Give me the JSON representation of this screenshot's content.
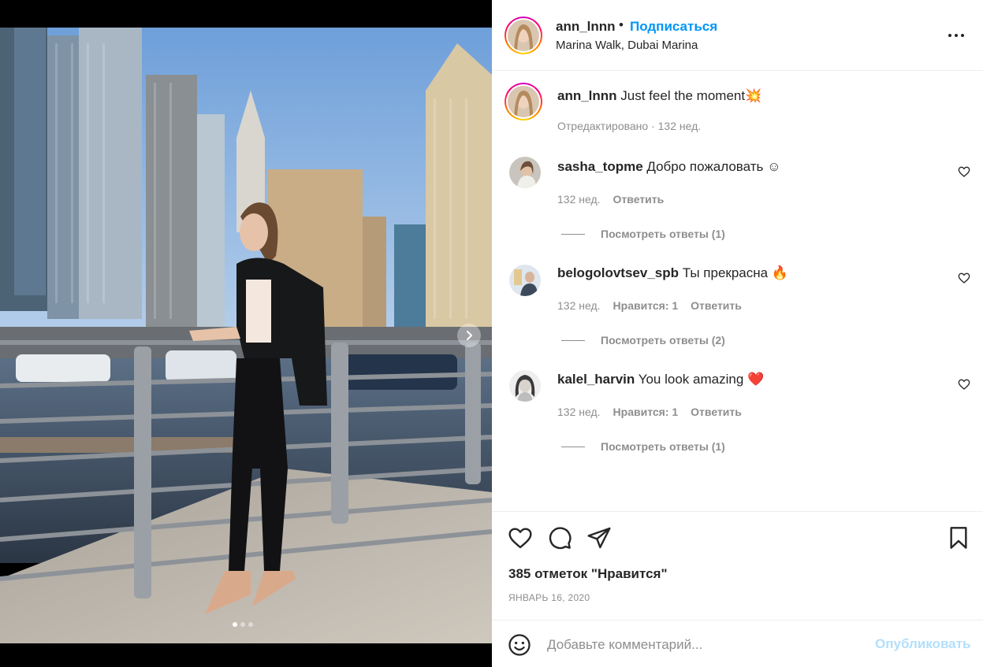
{
  "post": {
    "username": "ann_lnnn",
    "dot": "•",
    "follow_label": "Подписаться",
    "location": "Marina Walk, Dubai Marina",
    "more_icon": "more-horizontal-icon"
  },
  "media": {
    "carousel_dots": 3,
    "active_dot": 0,
    "next_icon": "chevron-right-icon"
  },
  "caption": {
    "username": "ann_lnnn",
    "text": " Just feel the moment",
    "emoji": "💥",
    "meta": "Отредактировано · 132 нед."
  },
  "comments": [
    {
      "username": "sasha_topme",
      "text": " Добро пожаловать ☺",
      "emoji": "",
      "time": "132 нед.",
      "likes_label": "",
      "reply_label": "Ответить",
      "view_replies": "Посмотреть ответы (1)"
    },
    {
      "username": "belogolovtsev_spb",
      "text": " Ты прекрасна ",
      "emoji": "🔥",
      "time": "132 нед.",
      "likes_label": "Нравится: 1",
      "reply_label": "Ответить",
      "view_replies": "Посмотреть ответы (2)"
    },
    {
      "username": "kalel_harvin",
      "text": " You look amazing ",
      "emoji": "❤️",
      "time": "132 нед.",
      "likes_label": "Нравится: 1",
      "reply_label": "Ответить",
      "view_replies": "Посмотреть ответы (1)"
    }
  ],
  "actions": {
    "like_icon": "heart-icon",
    "comment_icon": "comment-icon",
    "share_icon": "share-icon",
    "save_icon": "bookmark-icon",
    "likes_text": "385 отметок \"Нравится\"",
    "date": "ЯНВАРЬ 16, 2020"
  },
  "add_comment": {
    "emoji_icon": "smiley-icon",
    "placeholder": "Добавьте комментарий...",
    "publish_label": "Опубликовать"
  },
  "colors": {
    "link_blue": "#0095f6",
    "publish_disabled": "#b2dffc",
    "muted": "#8e8e8e",
    "text": "#262626"
  }
}
